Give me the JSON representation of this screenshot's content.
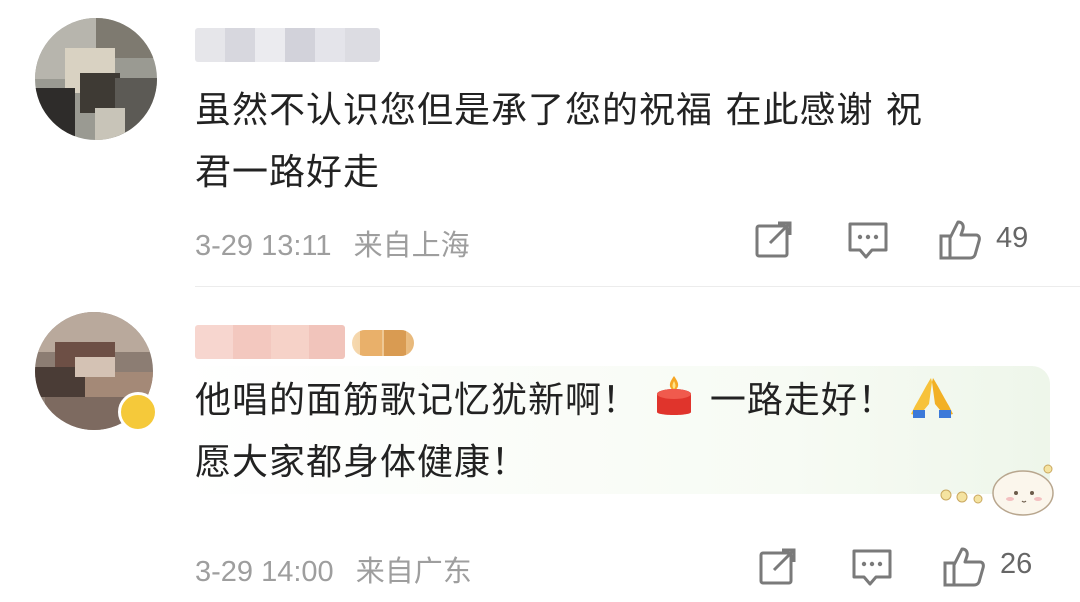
{
  "comments": [
    {
      "username": "",
      "text_line1": "虽然不认识您但是承了您的祝福  在此感谢 祝",
      "text_line2": "君一路好走",
      "date": "3-29 13:11",
      "location": "来自上海",
      "likes": "49",
      "icons": [
        "share-icon",
        "comment-icon",
        "thumbs-up-icon"
      ]
    },
    {
      "username": "",
      "text_part1": "他唱的面筋歌记忆犹新啊！",
      "emoji1": "candle-emoji",
      "text_part2": "一路走好！",
      "emoji2": "folded-hands-emoji",
      "text_line2": "愿大家都身体健康！",
      "date": "3-29 14:00",
      "location": "来自广东",
      "likes": "26",
      "icons": [
        "share-icon",
        "comment-icon",
        "thumbs-up-icon"
      ]
    }
  ],
  "colors": {
    "meta_text": "#9e9e9e",
    "body_text": "#222222",
    "icon_stroke": "#7a7a7a",
    "badge_gold": "#e8b87a",
    "verified_yellow": "#f5c93a"
  }
}
